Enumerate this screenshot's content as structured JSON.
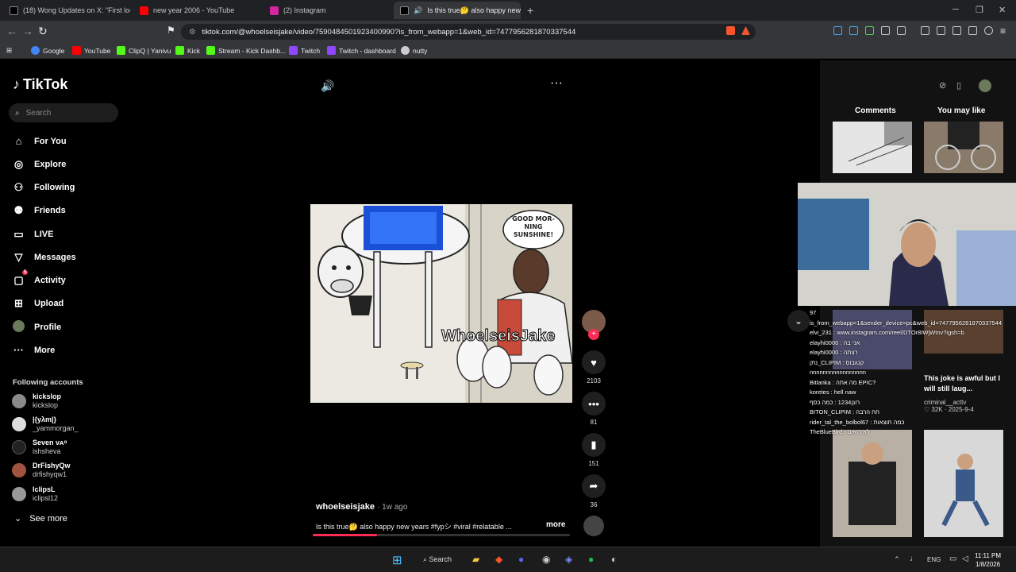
{
  "browser": {
    "tabs": [
      {
        "label": "(18) Wong Updates on X: \"First look",
        "favicon_color": "#000000"
      },
      {
        "label": "new year 2006 - YouTube",
        "favicon_color": "#ff0000"
      },
      {
        "label": "(2) Instagram",
        "favicon_color": "#d6249f"
      },
      {
        "label": "Is this true🤔 also happy new",
        "favicon_color": "#000000"
      }
    ],
    "url": "tiktok.com/@whoelseisjake/video/7590484501923400990?is_from_webapp=1&web_id=7477956281870337544",
    "bookmarks": [
      "Google",
      "YouTube",
      "ClipQ | Yanivu",
      "Kick",
      "Stream - Kick Dashb...",
      "Twitch",
      "Twitch - dashboard",
      "nutty"
    ]
  },
  "sidebar": {
    "logo": "TikTok",
    "search_placeholder": "Search",
    "nav": [
      {
        "label": "For You",
        "icon": "home-icon"
      },
      {
        "label": "Explore",
        "icon": "compass-icon"
      },
      {
        "label": "Following",
        "icon": "following-icon"
      },
      {
        "label": "Friends",
        "icon": "friends-icon"
      },
      {
        "label": "LIVE",
        "icon": "live-icon"
      },
      {
        "label": "Messages",
        "icon": "messages-icon"
      },
      {
        "label": "Activity",
        "icon": "activity-icon",
        "badge": "5"
      },
      {
        "label": "Upload",
        "icon": "upload-icon"
      },
      {
        "label": "Profile",
        "icon": "avatar"
      },
      {
        "label": "More",
        "icon": "more-icon"
      }
    ],
    "following_title": "Following accounts",
    "accounts": [
      {
        "name": "kickslop",
        "handle": "kickslop"
      },
      {
        "name": "|{yλm|}",
        "handle": "_yammorgan_"
      },
      {
        "name": "Seven ᴠᴀ⁸",
        "handle": "ishsheva"
      },
      {
        "name": "DrFishyQw",
        "handle": "drfishyqw1"
      },
      {
        "name": "lclipsL",
        "handle": "iclipsl12"
      }
    ],
    "see_more": "See more"
  },
  "video": {
    "watermark": "WhoelseisJake",
    "speech": "GOOD MOR-NING SUNSHINE!",
    "author": "whoelseisjake",
    "time": "· 1w ago",
    "caption": "Is this true🤔 also happy new years #fypシ #viral #relatable ...",
    "more": "more",
    "progress_percent": 25,
    "likes": "2103",
    "comments": "81",
    "saves": "151",
    "shares": "36"
  },
  "right_panel": {
    "tab_comments": "Comments",
    "tab_you_may_like": "You may like",
    "suggest_title": "This joke is awful but I will still laug...",
    "suggest_author": "criminal__acttv",
    "suggest_likes": "32K",
    "suggest_date": "2025-9-4"
  },
  "chat": [
    "97",
    "is_from_webapp=1&sender_device=pc&web_id=7477956281870337544",
    "elvi_231 : www.instagram.com/reel/DTOr8IWjWtnv?igsh=b",
    "elayhi0000 : אני בה",
    "elayhi0000 : רצתה",
    "נתן_CLIPIM : קטובוס",
    "nnnnnnnnnnnnnnnnn",
    "Bitlanka : מה אתה EPIC?",
    "koretes : hell naw",
    "רונן1234 : כמה כסף",
    "BITON_CLIPIM : חח הרבה",
    "rider_tal_the_bolbol67 : כמה תוצאות",
    "TheBlueBird : לא רואים"
  ],
  "taskbar": {
    "search_label": "Search",
    "lang": "ENG",
    "time": "11:11 PM",
    "date": "1/8/2026"
  }
}
